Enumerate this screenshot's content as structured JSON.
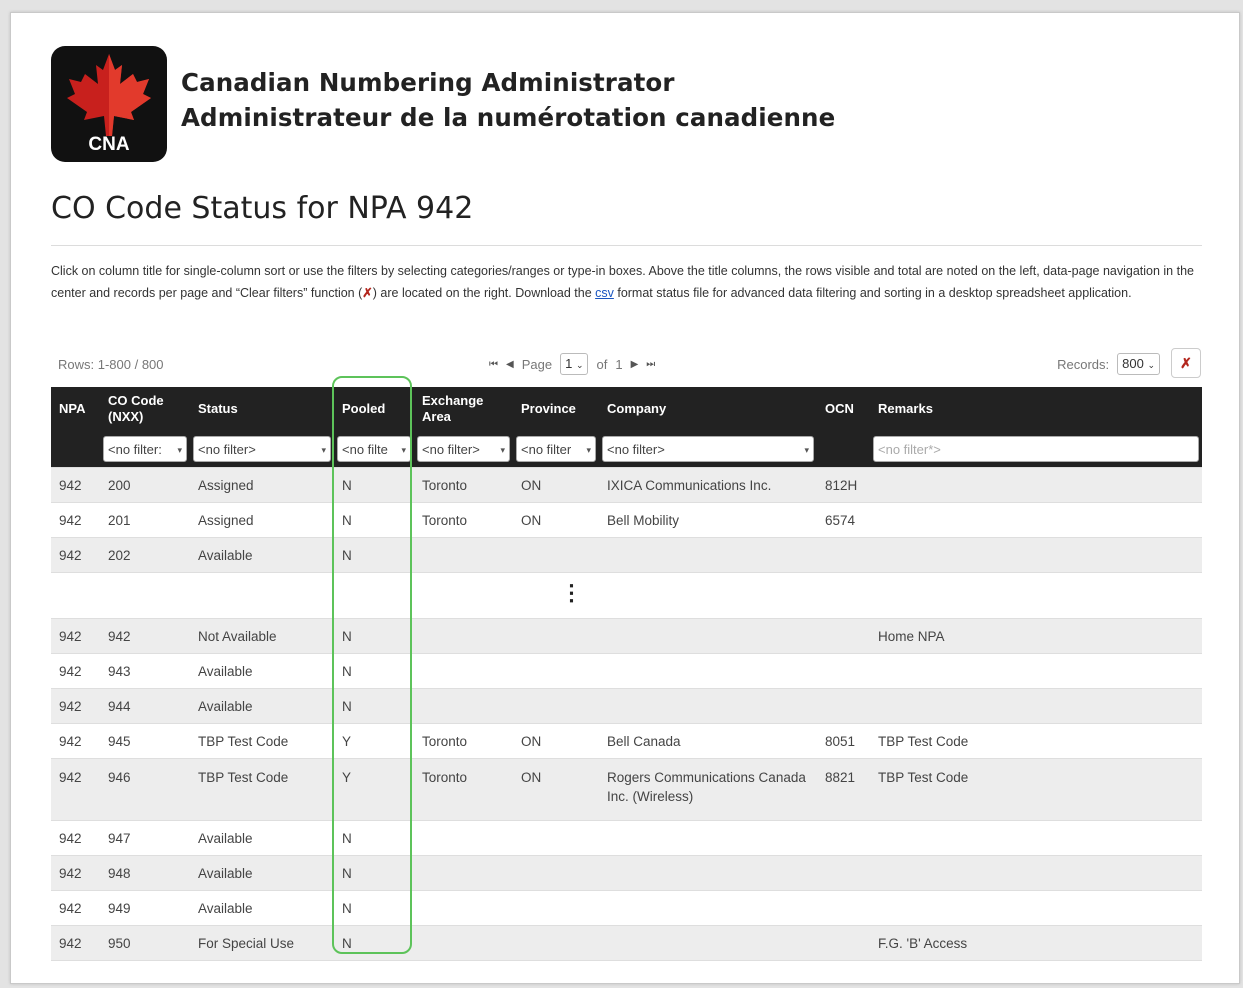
{
  "header": {
    "logo_text": "CNA",
    "org_en": "Canadian Numbering Administrator",
    "org_fr": "Administrateur de la numérotation canadienne"
  },
  "page_title": "CO Code Status for NPA 942",
  "description": {
    "part1": "Click on column title for single-column sort or use the filters by selecting categories/ranges or type-in boxes. Above the title columns, the rows visible and total are noted on the left, data-page navigation in the center and records per page and “Clear filters” function (",
    "part2": ") are located on the right. Download the ",
    "csv_link": "csv",
    "part3": " format status file for advanced data filtering and sorting in a desktop spreadsheet application."
  },
  "controls": {
    "rows_info": "Rows: 1-800 / 800",
    "page_label": "Page",
    "page_value": "1",
    "of_label": "of",
    "page_total": "1",
    "records_label": "Records:",
    "records_value": "800"
  },
  "columns": {
    "npa": "NPA",
    "co_code": "CO Code (NXX)",
    "status": "Status",
    "pooled": "Pooled",
    "exchange": "Exchange Area",
    "province": "Province",
    "company": "Company",
    "ocn": "OCN",
    "remarks": "Remarks"
  },
  "filters": {
    "co_code": "<no filter:",
    "status": "<no filter>",
    "pooled": "<no filte",
    "exchange": "<no filter>",
    "province": "<no filter",
    "company": "<no filter>",
    "remarks_placeholder": "<no filter*>"
  },
  "rows": [
    {
      "npa": "942",
      "code": "200",
      "status": "Assigned",
      "pooled": "N",
      "exchange": "Toronto",
      "province": "ON",
      "company": "IXICA Communications Inc.",
      "ocn": "812H",
      "remarks": ""
    },
    {
      "npa": "942",
      "code": "201",
      "status": "Assigned",
      "pooled": "N",
      "exchange": "Toronto",
      "province": "ON",
      "company": "Bell Mobility",
      "ocn": "6574",
      "remarks": ""
    },
    {
      "npa": "942",
      "code": "202",
      "status": "Available",
      "pooled": "N",
      "exchange": "",
      "province": "",
      "company": "",
      "ocn": "",
      "remarks": ""
    },
    {
      "npa": "942",
      "code": "942",
      "status": "Not Available",
      "pooled": "N",
      "exchange": "",
      "province": "",
      "company": "",
      "ocn": "",
      "remarks": "Home NPA"
    },
    {
      "npa": "942",
      "code": "943",
      "status": "Available",
      "pooled": "N",
      "exchange": "",
      "province": "",
      "company": "",
      "ocn": "",
      "remarks": ""
    },
    {
      "npa": "942",
      "code": "944",
      "status": "Available",
      "pooled": "N",
      "exchange": "",
      "province": "",
      "company": "",
      "ocn": "",
      "remarks": ""
    },
    {
      "npa": "942",
      "code": "945",
      "status": "TBP Test Code",
      "pooled": "Y",
      "exchange": "Toronto",
      "province": "ON",
      "company": "Bell Canada",
      "ocn": "8051",
      "remarks": "TBP Test Code"
    },
    {
      "npa": "942",
      "code": "946",
      "status": "TBP Test Code",
      "pooled": "Y",
      "exchange": "Toronto",
      "province": "ON",
      "company": "Rogers Communications Canada Inc. (Wireless)",
      "ocn": "8821",
      "remarks": "TBP Test Code"
    },
    {
      "npa": "942",
      "code": "947",
      "status": "Available",
      "pooled": "N",
      "exchange": "",
      "province": "",
      "company": "",
      "ocn": "",
      "remarks": ""
    },
    {
      "npa": "942",
      "code": "948",
      "status": "Available",
      "pooled": "N",
      "exchange": "",
      "province": "",
      "company": "",
      "ocn": "",
      "remarks": ""
    },
    {
      "npa": "942",
      "code": "949",
      "status": "Available",
      "pooled": "N",
      "exchange": "",
      "province": "",
      "company": "",
      "ocn": "",
      "remarks": ""
    },
    {
      "npa": "942",
      "code": "950",
      "status": "For Special Use",
      "pooled": "N",
      "exchange": "",
      "province": "",
      "company": "",
      "ocn": "",
      "remarks": "F.G. 'B' Access"
    }
  ],
  "ellipsis": "⋮",
  "icons": {
    "first": "first-page-icon",
    "prev": "prev-page-icon",
    "next": "next-page-icon",
    "last": "last-page-icon",
    "clear": "clear-filters-icon",
    "logo": "maple-leaf-icon"
  },
  "colors": {
    "header_bg": "#222222",
    "highlight": "#5dc35a",
    "logo_leaf": "#c8201d",
    "clear_icon": "#b3271e"
  }
}
